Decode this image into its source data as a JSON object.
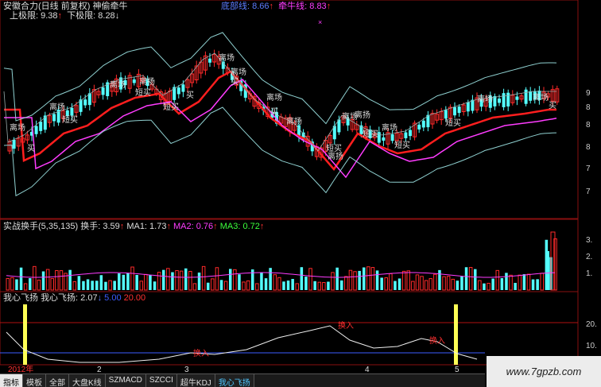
{
  "header": {
    "title": "安徽合力(日线 前复权)",
    "indicator_name": "神偷牵牛",
    "upper_label": "上极限: 9.38",
    "upper_arrow": "↑",
    "lower_label": "下极限: 8.28",
    "lower_arrow": "↓",
    "line1_label": "底部线: 8.66",
    "line1_arrow": "↑",
    "line2_label": "牵牛线: 8.83",
    "line2_arrow": "↑",
    "marker": "×"
  },
  "price_panel": {
    "y_ticks": [
      "9",
      "8",
      "8",
      "8",
      "7",
      "7"
    ],
    "annotations": {
      "li_chang": "离场",
      "duan_mai": "短买",
      "mai": "买",
      "li_yang": "离扬"
    }
  },
  "volume_panel": {
    "title": "实战换手(5,35,135)",
    "values": [
      {
        "label": "换手: 3.59",
        "arrow": "↑"
      },
      {
        "label": "MA1: 1.73",
        "arrow": "↑"
      },
      {
        "label": "MA2: 0.76",
        "arrow": "↑"
      },
      {
        "label": "MA3: 0.72",
        "arrow": "↑"
      }
    ],
    "y_ticks": [
      "3.",
      "2.",
      "1."
    ]
  },
  "signal_panel": {
    "title": "我心飞扬",
    "value_label": "我心飞扬: 2.07",
    "value_arrow": "↓",
    "level_low": "5.00",
    "level_high": "20.00",
    "y_ticks": [
      "20.",
      "10."
    ],
    "annotations": {
      "huan_ru": "换入"
    }
  },
  "dates": [
    "2012年",
    "2",
    "3",
    "4",
    "5"
  ],
  "tabs": [
    {
      "label": "指标",
      "selected": true
    },
    {
      "label": "模板"
    },
    {
      "label": "全部"
    },
    {
      "label": "大盘K线"
    },
    {
      "label": "SZMACD"
    },
    {
      "label": "SZCCI"
    },
    {
      "label": "超牛KDJ"
    },
    {
      "label": "我心飞扬",
      "highlight": true
    }
  ],
  "watermark": "www.7gpzb.com",
  "colors": {
    "up": "#ff2a2a",
    "down": "#54ffff",
    "ma_magenta": "#ff3cff",
    "ma_red": "#ff1e1e",
    "band": "#8fd0d0",
    "grid_red": "#8a1010",
    "signal_yellow": "#ffff55"
  }
}
